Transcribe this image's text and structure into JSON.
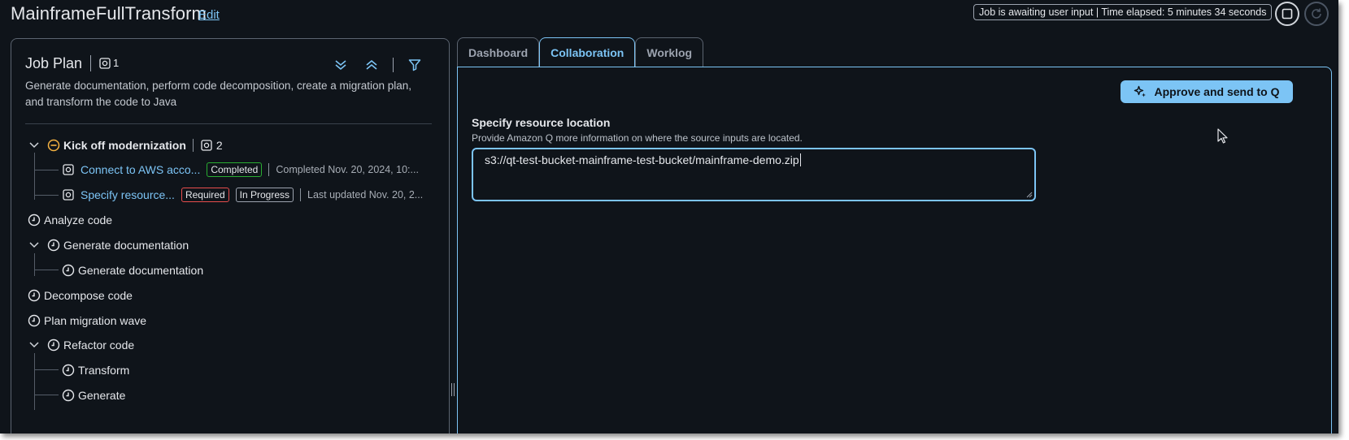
{
  "header": {
    "title": "MainframeFullTransform",
    "edit_label": "Edit",
    "status": "Job is awaiting user input | Time elapsed: 5 minutes 34 seconds"
  },
  "job_plan": {
    "title": "Job Plan",
    "count": "1",
    "description": "Generate documentation, perform code decomposition, create a migration plan, and transform the code to Java",
    "items": [
      {
        "label": "Kick off modernization",
        "count": "2",
        "children": [
          {
            "label": "Connect to AWS acco...",
            "badges": [
              "Completed"
            ],
            "meta": "Completed Nov. 20, 2024, 10:..."
          },
          {
            "label": "Specify resource...",
            "badges": [
              "Required",
              "In Progress"
            ],
            "meta": "Last updated Nov. 20, 2..."
          }
        ]
      },
      {
        "label": "Analyze code"
      },
      {
        "label": "Generate documentation",
        "children": [
          {
            "label": "Generate documentation"
          }
        ]
      },
      {
        "label": "Decompose code"
      },
      {
        "label": "Plan migration wave"
      },
      {
        "label": "Refactor code",
        "children": [
          {
            "label": "Transform"
          },
          {
            "label": "Generate"
          }
        ]
      }
    ]
  },
  "tabs": [
    "Dashboard",
    "Collaboration",
    "Worklog"
  ],
  "active_tab": "Collaboration",
  "collaboration": {
    "approve_label": "Approve and send to Q",
    "field_label": "Specify resource location",
    "field_description": "Provide Amazon Q more information on where the source inputs are located.",
    "field_value": "s3://qt-test-bucket-mainframe-test-bucket/mainframe-demo.zip"
  },
  "colors": {
    "background": "#0f141a",
    "accent": "#7cc4f5",
    "completed": "#29ad32",
    "required": "#e84d4d"
  },
  "icons": [
    "stop-icon",
    "refresh-icon",
    "expand-all-icon",
    "collapse-all-icon",
    "filter-icon",
    "chevron-down-icon",
    "in-progress-icon",
    "step-icon",
    "clock-icon",
    "sparkle-icon",
    "mouse-cursor-icon"
  ]
}
